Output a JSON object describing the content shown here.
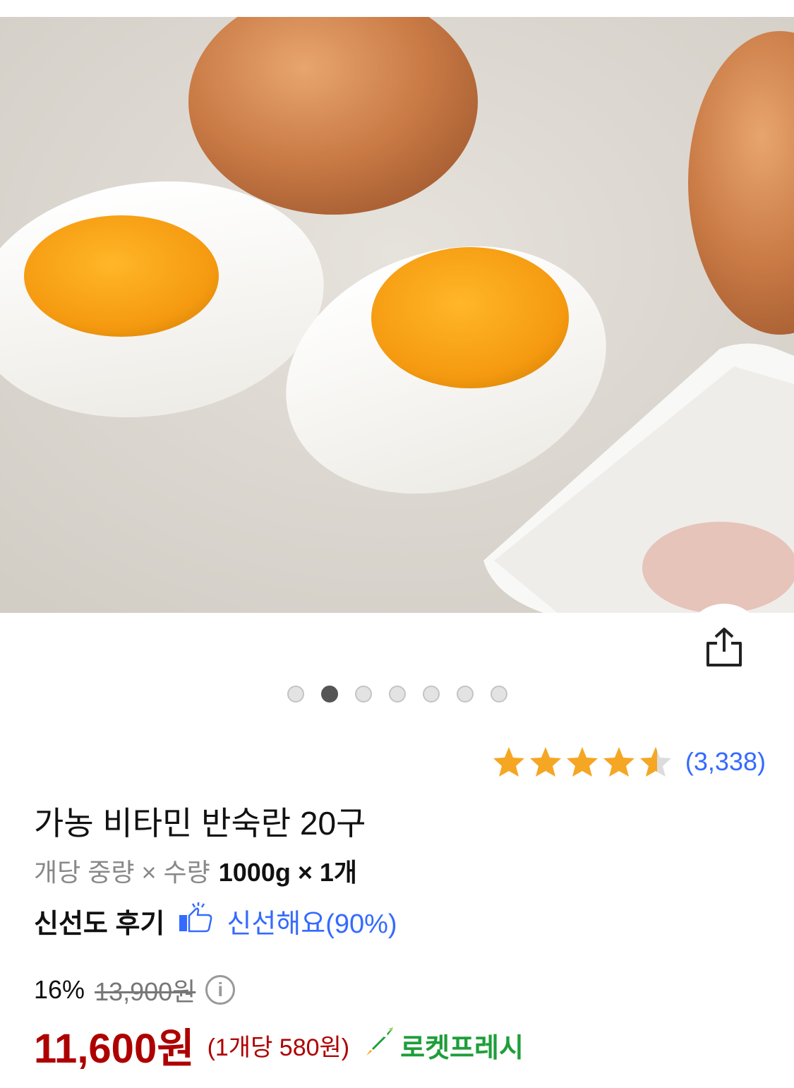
{
  "product": {
    "title": "가농 비타민 반숙란 20구",
    "spec_label": "개당 중량 × 수량",
    "spec_value": "1000g × 1개",
    "freshness_label": "신선도 후기",
    "freshness_text": "신선해요(90%)"
  },
  "rating": {
    "stars": 4.5,
    "review_count": "(3,338)",
    "star_color": "#f5a623"
  },
  "gallery": {
    "total_images": 7,
    "active_index": 1
  },
  "pricing": {
    "discount_percent": "16%",
    "original_price": "13,900원",
    "sale_price": "11,600원",
    "unit_price": "(1개당 580원)",
    "price_color": "#ae0000"
  },
  "delivery": {
    "badge_label": "로켓프레시",
    "badge_color": "#1e9e3a"
  },
  "icons": {
    "share": "share-icon",
    "info": "info-icon",
    "thumbs_up": "thumbs-up-icon",
    "rocket": "rocket-icon"
  }
}
